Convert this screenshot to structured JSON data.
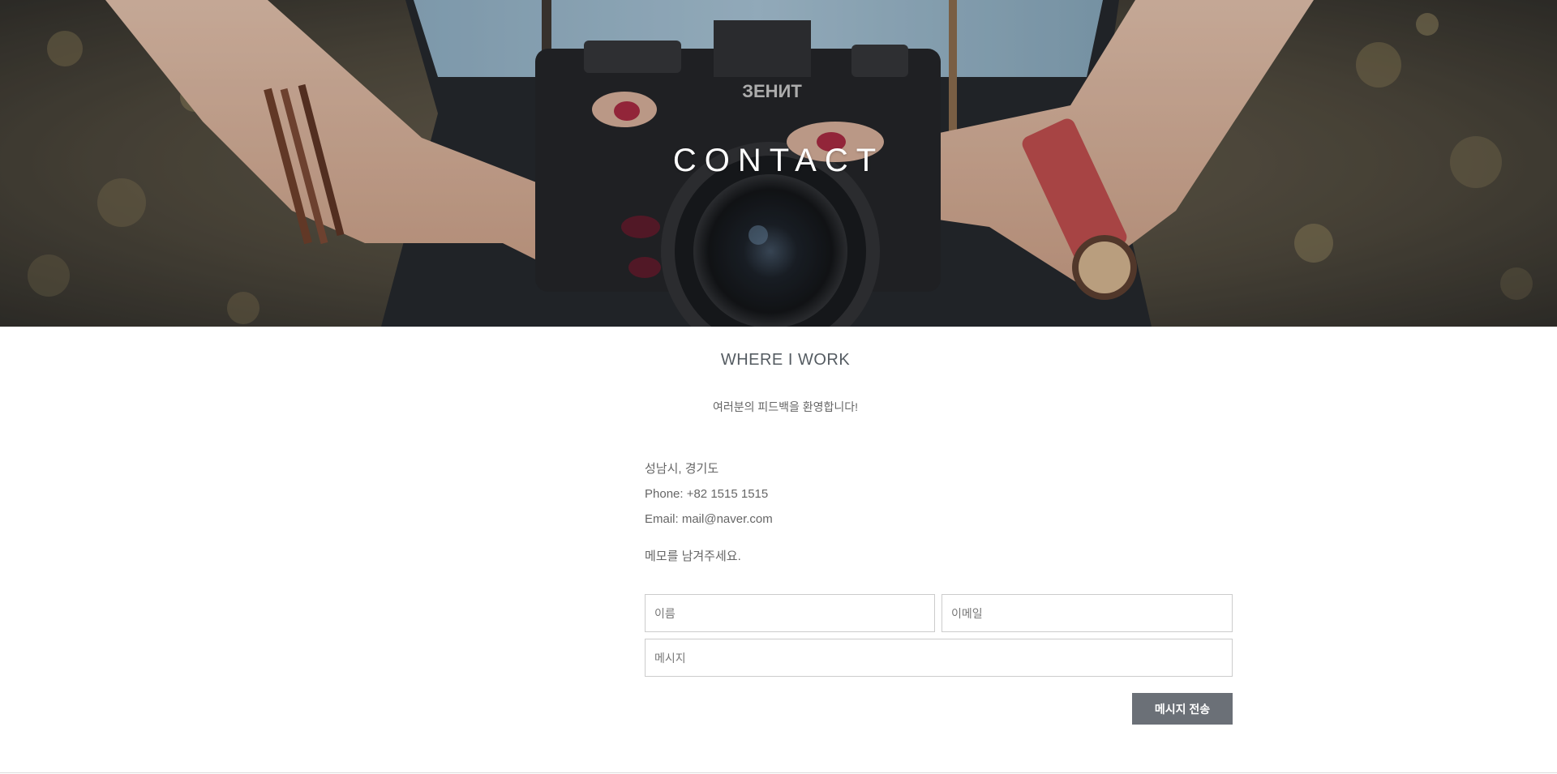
{
  "hero": {
    "title": "CONTACT",
    "camera_brand": "ЗЕНИТ"
  },
  "section": {
    "title": "WHERE I WORK",
    "subtitle": "여러분의 피드백을 환영합니다!"
  },
  "contact_info": {
    "address": "성남시, 경기도",
    "phone": "Phone: +82 1515 1515",
    "email": "Email: mail@naver.com"
  },
  "memo_prompt": "메모를 남겨주세요.",
  "form": {
    "name_placeholder": "이름",
    "email_placeholder": "이메일",
    "message_placeholder": "메시지",
    "submit_label": "메시지 전송"
  },
  "colors": {
    "button_bg": "#6b7077",
    "field_border": "#cccccc",
    "text": "#666666"
  }
}
